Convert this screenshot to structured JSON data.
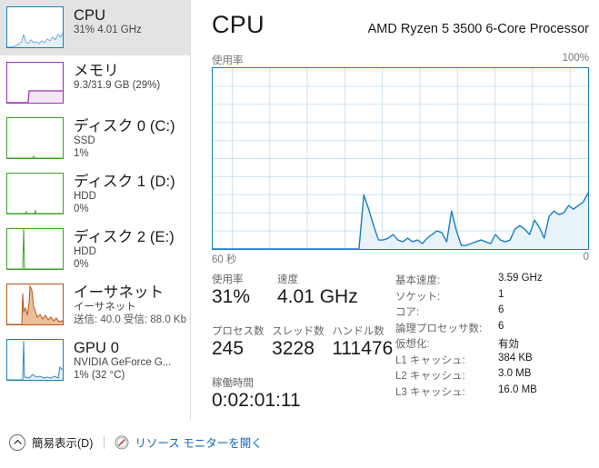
{
  "sidebar": {
    "items": [
      {
        "name": "cpu",
        "title": "CPU",
        "sub1": "31%  4.01 GHz",
        "sub2": "",
        "sub3": "",
        "selected": true,
        "color": "#1a7fc1",
        "thumb_kind": "line"
      },
      {
        "name": "memory",
        "title": "メモリ",
        "sub1": "9.3/31.9 GB (29%)",
        "sub2": "",
        "sub3": "",
        "selected": false,
        "color": "#9b30b5",
        "thumb_kind": "step"
      },
      {
        "name": "disk0",
        "title": "ディスク 0 (C:)",
        "sub1": "SSD",
        "sub2": "1%",
        "sub3": "",
        "selected": false,
        "color": "#3fa22c",
        "thumb_kind": "flat-green"
      },
      {
        "name": "disk1",
        "title": "ディスク 1 (D:)",
        "sub1": "HDD",
        "sub2": "0%",
        "sub3": "",
        "selected": false,
        "color": "#3fa22c",
        "thumb_kind": "flat-green"
      },
      {
        "name": "disk2",
        "title": "ディスク 2 (E:)",
        "sub1": "HDD",
        "sub2": "0%",
        "sub3": "",
        "selected": false,
        "color": "#3fa22c",
        "thumb_kind": "spike-green"
      },
      {
        "name": "ethernet",
        "title": "イーサネット",
        "sub1": "イーサネット",
        "sub2": "送信: 40.0 受信: 88.0 Kb",
        "sub3": "",
        "selected": false,
        "color": "#b75416",
        "thumb_kind": "bars-orange"
      },
      {
        "name": "gpu0",
        "title": "GPU 0",
        "sub1": "NVIDIA GeForce G...",
        "sub2": "1%  (32 °C)",
        "sub3": "",
        "selected": false,
        "color": "#1a7fc1",
        "thumb_kind": "spike-blue"
      }
    ]
  },
  "main": {
    "heading": "CPU",
    "model": "AMD Ryzen 5 3500 6-Core Processor",
    "axis_top_left": "使用率",
    "axis_top_right": "100%",
    "axis_bottom_left": "60 秒",
    "axis_bottom_right": "0"
  },
  "stats": {
    "utilization_label": "使用率",
    "utilization_value": "31%",
    "speed_label": "速度",
    "speed_value": "4.01 GHz",
    "processes_label": "プロセス数",
    "processes_value": "245",
    "threads_label": "スレッド数",
    "threads_value": "3228",
    "handles_label": "ハンドル数",
    "handles_value": "111476",
    "uptime_label": "稼働時間",
    "uptime_value": "0:02:01:11"
  },
  "specs": [
    {
      "key": "基本速度:",
      "value": "3.59 GHz"
    },
    {
      "key": "ソケット:",
      "value": "1"
    },
    {
      "key": "コア:",
      "value": "6"
    },
    {
      "key": "論理プロセッサ数:",
      "value": "6"
    },
    {
      "key": "仮想化:",
      "value": "有効"
    },
    {
      "key": "L1 キャッシュ:",
      "value": "384 KB"
    },
    {
      "key": "L2 キャッシュ:",
      "value": "3.0 MB"
    },
    {
      "key": "L3 キャッシュ:",
      "value": "16.0 MB"
    }
  ],
  "statusbar": {
    "collapse_label": "簡易表示(D)",
    "resmon_label": "リソース モニターを開く",
    "link_color": "#1268c0"
  },
  "chart_data": {
    "type": "area",
    "title": "CPU 使用率",
    "xlabel": "",
    "ylabel": "使用率",
    "ylim": [
      0,
      100
    ],
    "xlim": [
      60,
      0
    ],
    "x_axis_left_label": "60 秒",
    "x_axis_right_label": "0",
    "y_axis_top_label": "100%",
    "grid": true,
    "grid_rows": 10,
    "grid_cols": 10,
    "line_color": "#1a7fc1",
    "fill_color": "#e8f2f9",
    "current_value": 31,
    "series": [
      {
        "name": "使用率",
        "values": [
          0,
          0,
          0,
          0,
          0,
          0,
          0,
          0,
          0,
          0,
          0,
          0,
          0,
          0,
          0,
          0,
          0,
          0,
          0,
          0,
          0,
          0,
          0,
          0,
          0,
          0,
          0,
          0,
          0,
          0,
          0,
          30,
          22,
          13,
          5,
          5,
          6,
          8,
          5,
          4,
          6,
          4,
          5,
          3,
          6,
          8,
          10,
          9,
          4,
          21,
          10,
          2,
          2,
          3,
          4,
          5,
          4,
          3,
          8,
          5,
          4,
          5,
          11,
          13,
          11,
          8,
          16,
          12,
          6,
          18,
          21,
          19,
          20,
          24,
          22,
          24,
          26,
          31
        ]
      }
    ]
  }
}
